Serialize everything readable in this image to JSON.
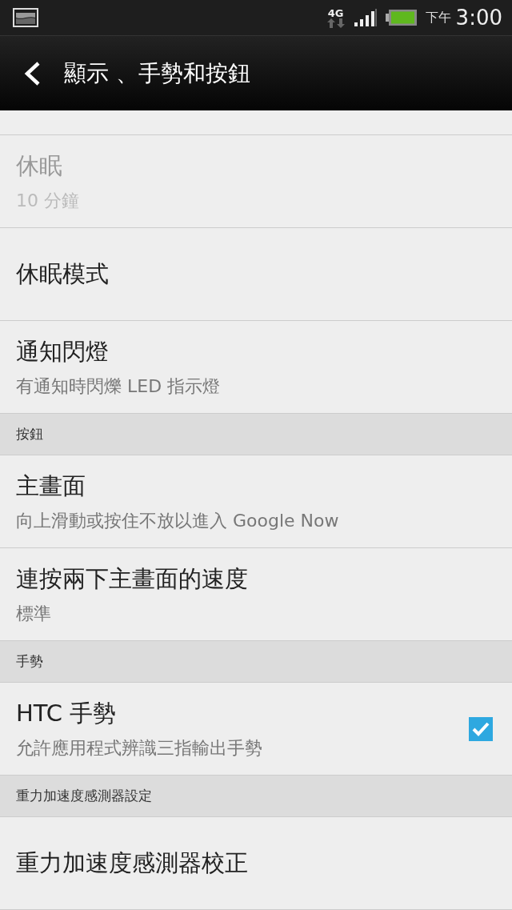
{
  "status_bar": {
    "network": "4G",
    "time_period": "下午",
    "time": "3:00"
  },
  "action_bar": {
    "title": "顯示 、手勢和按鈕"
  },
  "list": [
    {
      "kind": "item",
      "title": "休眠",
      "summary": "10 分鐘",
      "disabled": true
    },
    {
      "kind": "item",
      "title": "休眠模式",
      "disabled": false
    },
    {
      "kind": "item",
      "title": "通知閃燈",
      "summary": "有通知時閃爍 LED 指示燈",
      "disabled": false
    },
    {
      "kind": "header",
      "title": "按鈕"
    },
    {
      "kind": "item",
      "title": "主畫面",
      "summary": "向上滑動或按住不放以進入 Google Now",
      "disabled": false
    },
    {
      "kind": "item",
      "title": "連按兩下主畫面的速度",
      "summary": "標準",
      "disabled": false
    },
    {
      "kind": "header",
      "title": "手勢"
    },
    {
      "kind": "item",
      "title": "HTC 手勢",
      "summary": "允許應用程式辨識三指輸出手勢",
      "disabled": false,
      "checked": true
    },
    {
      "kind": "header",
      "title": "重力加速度感測器設定"
    },
    {
      "kind": "item",
      "title": "重力加速度感測器校正",
      "disabled": false
    }
  ]
}
